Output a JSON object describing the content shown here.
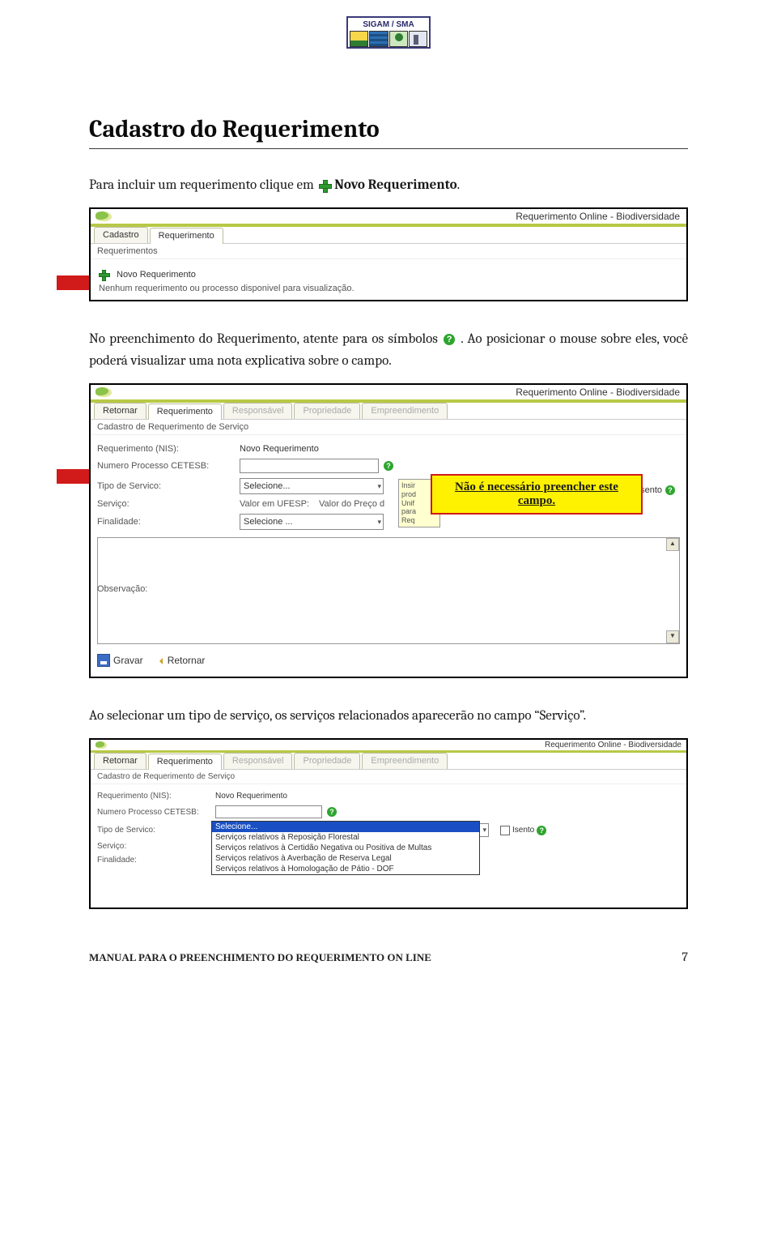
{
  "header": {
    "logo_text": "SIGAM / SMA"
  },
  "title": "Cadastro do Requerimento",
  "para1_prefix": "Para incluir um requerimento clique em ",
  "para1_bold": "Novo Requerimento",
  "para2_prefix": "No preenchimento do Requerimento, atente para os símbolos ",
  "para2_suffix": ". Ao posicionar o mouse sobre eles, você poderá visualizar uma nota explicativa sobre o campo.",
  "para3": "Ao selecionar um tipo de serviço, os serviços relacionados aparecerão no campo “Serviço”.",
  "callout": "Não é necessário preencher este campo.",
  "ss1": {
    "title": "Requerimento Online - Biodiversidade",
    "tab1": "Cadastro",
    "tab2": "Requerimento",
    "sub": "Requerimentos",
    "novo": "Novo Requerimento",
    "msg": "Nenhum requerimento ou processo disponivel para visualização."
  },
  "ss2": {
    "title": "Requerimento Online - Biodiversidade",
    "tabs": [
      "Retornar",
      "Requerimento",
      "Responsável",
      "Propriedade",
      "Empreendimento"
    ],
    "header_line": "Cadastro de Requerimento de Serviço",
    "labels": {
      "req_nis": "Requerimento (NIS):",
      "num_proc": "Numero Processo CETESB:",
      "tipo": "Tipo de Servico:",
      "servico": "Serviço:",
      "finalidade": "Finalidade:",
      "obs": "Observação:"
    },
    "values": {
      "req_nis": "Novo Requerimento",
      "tipo_sel": "Selecione...",
      "valor_label": "Valor em UFESP:",
      "valor_text": "Valor do Preço d",
      "fin_sel": "Selecione ...",
      "isento": "Isento"
    },
    "tooltip_lines": [
      "Insir",
      "prod",
      "Unif",
      "para",
      "Req"
    ],
    "gravar": "Gravar",
    "retornar": "Retornar"
  },
  "ss3": {
    "title": "Requerimento Online - Biodiversidade",
    "tabs": [
      "Retornar",
      "Requerimento",
      "Responsável",
      "Propriedade",
      "Empreendimento"
    ],
    "header_line": "Cadastro de Requerimento de Serviço",
    "labels": {
      "req_nis": "Requerimento (NIS):",
      "num_proc": "Numero Processo CETESB:",
      "tipo": "Tipo de Servico:",
      "servico": "Serviço:",
      "finalidade": "Finalidade:"
    },
    "values": {
      "req_nis": "Novo Requerimento",
      "tipo_sel": "Selecione...",
      "isento": "Isento"
    },
    "dropdown": [
      "Selecione...",
      "Serviços relativos à Reposição Florestal",
      "Serviços relativos à Certidão Negativa ou Positiva de Multas",
      "Serviços relativos à Averbação de Reserva Legal",
      "Serviços relativos à Homologação de Pátio - DOF"
    ]
  },
  "footer": {
    "text": "MANUAL PARA O PREENCHIMENTO DO REQUERIMENTO ON LINE",
    "page": "7"
  }
}
